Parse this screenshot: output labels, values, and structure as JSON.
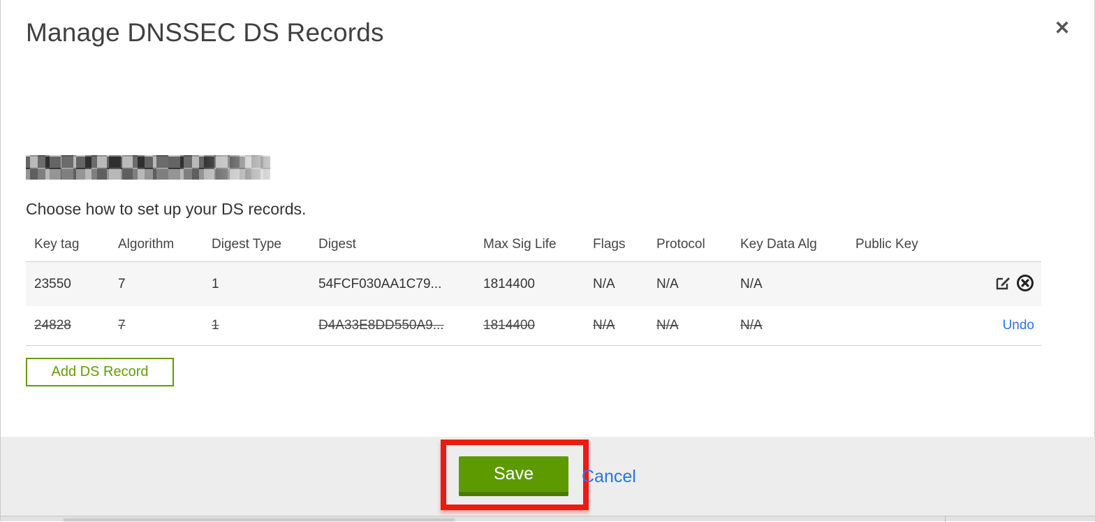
{
  "modal": {
    "title": "Manage DNSSEC DS Records",
    "close_glyph": "✕",
    "intro": "Choose how to set up your DS records.",
    "table": {
      "columns": [
        "Key tag",
        "Algorithm",
        "Digest Type",
        "Digest",
        "Max Sig Life",
        "Flags",
        "Protocol",
        "Key Data Alg",
        "Public Key"
      ],
      "rows": [
        {
          "key_tag": "23550",
          "algorithm": "7",
          "digest_type": "1",
          "digest": "54FCF030AA1C79...",
          "max_sig_life": "1814400",
          "flags": "N/A",
          "protocol": "N/A",
          "key_data_alg": "N/A",
          "public_key": "",
          "state": "normal"
        },
        {
          "key_tag": "24828",
          "algorithm": "7",
          "digest_type": "1",
          "digest": "D4A33E8DD550A9...",
          "max_sig_life": "1814400",
          "flags": "N/A",
          "protocol": "N/A",
          "key_data_alg": "N/A",
          "public_key": "",
          "state": "deleted",
          "undo_label": "Undo"
        }
      ]
    },
    "add_button_label": "Add DS Record",
    "footer": {
      "save_label": "Save",
      "cancel_label": "Cancel"
    }
  },
  "icons": {
    "close": "x-mark",
    "edit": "pencil-square",
    "delete": "circle-x"
  },
  "colors": {
    "button_green": "#5d9a00",
    "button_green_border": "#4a7c00",
    "outline_green": "#649b00",
    "link_blue": "#2b74e2",
    "annotation_red": "#ec1a12",
    "footer_gray": "#ededed",
    "row_stripe_gray": "#f6f6f6"
  }
}
